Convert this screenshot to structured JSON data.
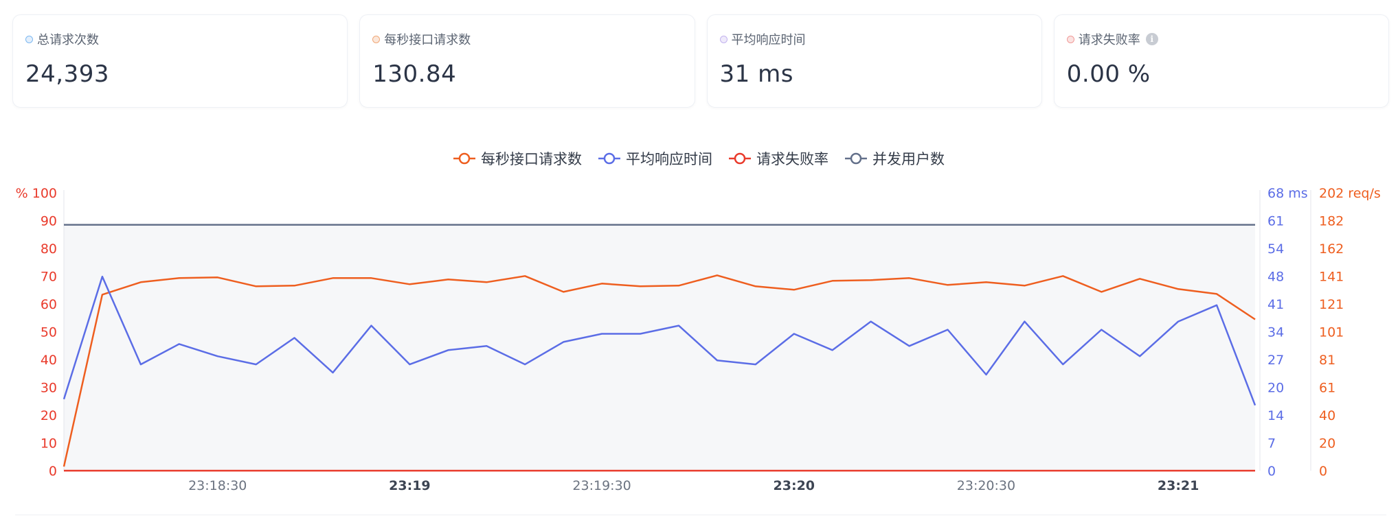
{
  "cards": [
    {
      "title": "总请求次数",
      "value": "24,393",
      "color": "#7db8f0"
    },
    {
      "title": "每秒接口请求数",
      "value": "130.84",
      "color": "#f0a878"
    },
    {
      "title": "平均响应时间",
      "value": "31 ms",
      "color": "#c2b3ee"
    },
    {
      "title": "请求失败率",
      "value": "0.00 %",
      "color": "#f09a98",
      "info_icon": "info-icon"
    }
  ],
  "chart_data": {
    "type": "line",
    "legend_position": "top-center",
    "grid": false,
    "series": [
      {
        "name": "每秒接口请求数",
        "color": "#ee5e1f",
        "axis": "right-reqs",
        "values": [
          3,
          128,
          137,
          140,
          140.5,
          134,
          134.5,
          140,
          140,
          135.5,
          139,
          137,
          141.5,
          130,
          136,
          134,
          134.5,
          142,
          134,
          131.5,
          138,
          138.5,
          140,
          135,
          137,
          134.5,
          141.5,
          130,
          139.5,
          132,
          128.5,
          110
        ]
      },
      {
        "name": "平均响应时间",
        "color": "#5b6de6",
        "axis": "right-ms",
        "values": [
          17.5,
          47.5,
          26,
          31,
          28,
          26,
          32.5,
          24,
          35.5,
          26,
          29.5,
          30.5,
          26,
          31.5,
          33.5,
          33.5,
          35.5,
          27,
          26,
          33.5,
          29.5,
          36.5,
          30.5,
          34.5,
          23.5,
          36.5,
          26,
          34.5,
          28,
          36.5,
          40.5,
          16
        ]
      },
      {
        "name": "请求失败率",
        "color": "#e93a2b",
        "axis": "left-percent",
        "values": [
          0,
          0,
          0,
          0,
          0,
          0,
          0,
          0,
          0,
          0,
          0,
          0,
          0,
          0,
          0,
          0,
          0,
          0,
          0,
          0,
          0,
          0,
          0,
          0,
          0,
          0,
          0,
          0,
          0,
          0,
          0,
          0
        ]
      },
      {
        "name": "并发用户数",
        "color": "#63708a",
        "axis": "hidden-users",
        "values": [
          100,
          100,
          100,
          100,
          100,
          100,
          100,
          100,
          100,
          100,
          100,
          100,
          100,
          100,
          100,
          100,
          100,
          100,
          100,
          100,
          100,
          100,
          100,
          100,
          100,
          100,
          100,
          100,
          100,
          100,
          100,
          100
        ]
      }
    ],
    "x_ticks": [
      {
        "label": "23:18:30",
        "index": 4,
        "bold": false
      },
      {
        "label": "23:19",
        "index": 9,
        "bold": true
      },
      {
        "label": "23:19:30",
        "index": 14,
        "bold": false
      },
      {
        "label": "23:20",
        "index": 19,
        "bold": true
      },
      {
        "label": "23:20:30",
        "index": 24,
        "bold": false
      },
      {
        "label": "23:21",
        "index": 29,
        "bold": true
      }
    ],
    "left_axis": {
      "ylim": [
        0,
        100
      ],
      "ticks": [
        "0",
        "10",
        "20",
        "30",
        "40",
        "50",
        "60",
        "70",
        "80",
        "90",
        "100"
      ],
      "unit_label": "%",
      "color": "#e93a2b"
    },
    "right_axis_ms": {
      "ylim": [
        0,
        68
      ],
      "ticks": [
        "0",
        "7",
        "14",
        "20",
        "27",
        "34",
        "41",
        "48",
        "54",
        "61",
        "68 ms"
      ],
      "color": "#5b6de6"
    },
    "right_axis_reqs": {
      "ylim": [
        0,
        202
      ],
      "ticks": [
        "0",
        "20",
        "40",
        "61",
        "81",
        "101",
        "121",
        "141",
        "162",
        "182",
        "202 req/s"
      ],
      "color": "#ee5e1f"
    },
    "users_axis": {
      "ylim": [
        0,
        113
      ]
    }
  }
}
